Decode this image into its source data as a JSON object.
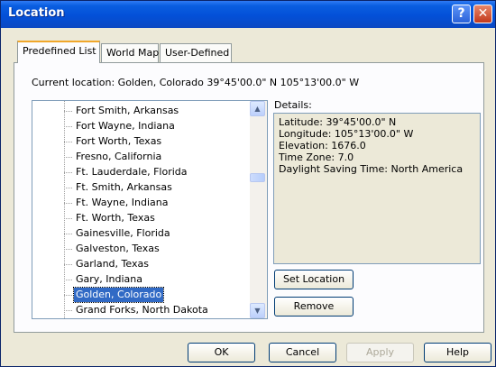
{
  "window": {
    "title": "Location",
    "help_glyph": "?",
    "close_glyph": "✕"
  },
  "tabs": [
    {
      "label": "Predefined List",
      "active": true
    },
    {
      "label": "World Map",
      "active": false
    },
    {
      "label": "User-Defined",
      "active": false
    }
  ],
  "current_location": {
    "label": "Current location:",
    "value": "Golden, Colorado 39°45'00.0\" N 105°13'00.0\" W"
  },
  "list": {
    "items": [
      "Fort Smith, Arkansas",
      "Fort Wayne, Indiana",
      "Fort Worth, Texas",
      "Fresno, California",
      "Ft. Lauderdale, Florida",
      "Ft. Smith, Arkansas",
      "Ft. Wayne, Indiana",
      "Ft. Worth, Texas",
      "Gainesville, Florida",
      "Galveston, Texas",
      "Garland, Texas",
      "Gary, Indiana",
      "Golden, Colorado",
      "Grand Forks, North Dakota"
    ],
    "selected": "Golden, Colorado"
  },
  "details": {
    "label": "Details:",
    "lines": [
      "Latitude: 39°45'00.0\" N",
      "Longitude: 105°13'00.0\" W",
      "Elevation: 1676.0",
      "Time Zone: 7.0",
      "Daylight Saving Time: North America"
    ]
  },
  "buttons": {
    "set_location": "Set Location",
    "remove": "Remove",
    "ok": "OK",
    "cancel": "Cancel",
    "apply": "Apply",
    "help": "Help"
  },
  "colors": {
    "selection": "#316ac5",
    "titlebar": "#0350d8",
    "active_tab_accent": "#f0a72b"
  }
}
